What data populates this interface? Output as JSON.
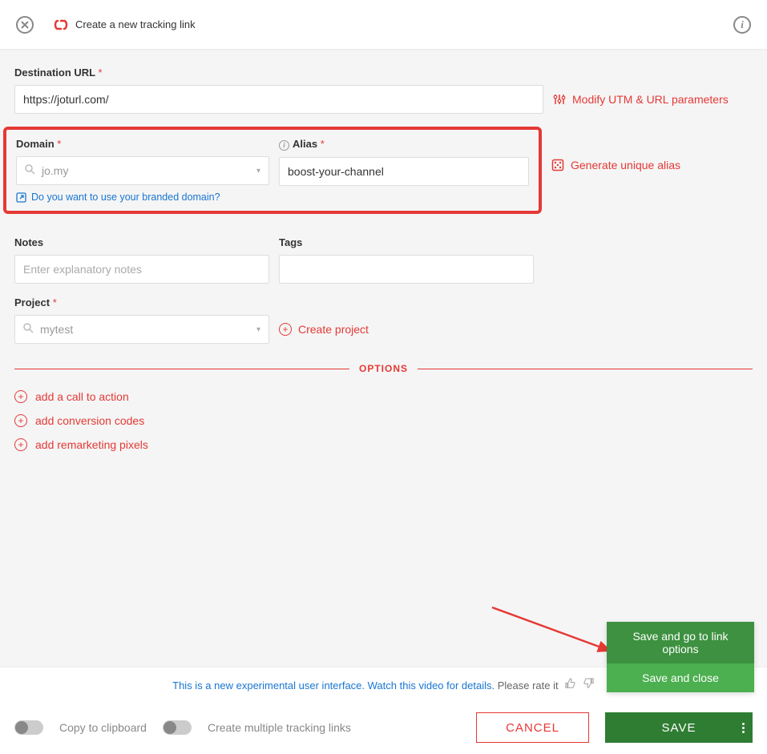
{
  "header": {
    "title": "Create a new tracking link"
  },
  "destination": {
    "label": "Destination URL",
    "required": "*",
    "value": "https://joturl.com/",
    "modify_link": "Modify UTM & URL parameters"
  },
  "domain": {
    "label": "Domain",
    "required": "*",
    "value": "jo.my",
    "branded_link": "Do you want to use your branded domain?"
  },
  "alias": {
    "label": "Alias",
    "required": "*",
    "value": "boost-your-channel",
    "generate_link": "Generate unique alias"
  },
  "notes": {
    "label": "Notes",
    "placeholder": "Enter explanatory notes"
  },
  "tags": {
    "label": "Tags"
  },
  "project": {
    "label": "Project",
    "required": "*",
    "value": "mytest",
    "create_link": "Create project"
  },
  "options": {
    "divider": "OPTIONS",
    "cta": "add a call to action",
    "conv": "add conversion codes",
    "remk": "add remarketing pixels"
  },
  "footer_note": {
    "link": "This is a new experimental user interface. Watch this video for details.",
    "rate": " Please rate it "
  },
  "footer": {
    "copy": "Copy to clipboard",
    "multi": "Create multiple tracking links",
    "cancel": "CANCEL",
    "save": "SAVE"
  },
  "save_menu": {
    "opt1": "Save and go to link options",
    "opt2": "Save and close"
  }
}
